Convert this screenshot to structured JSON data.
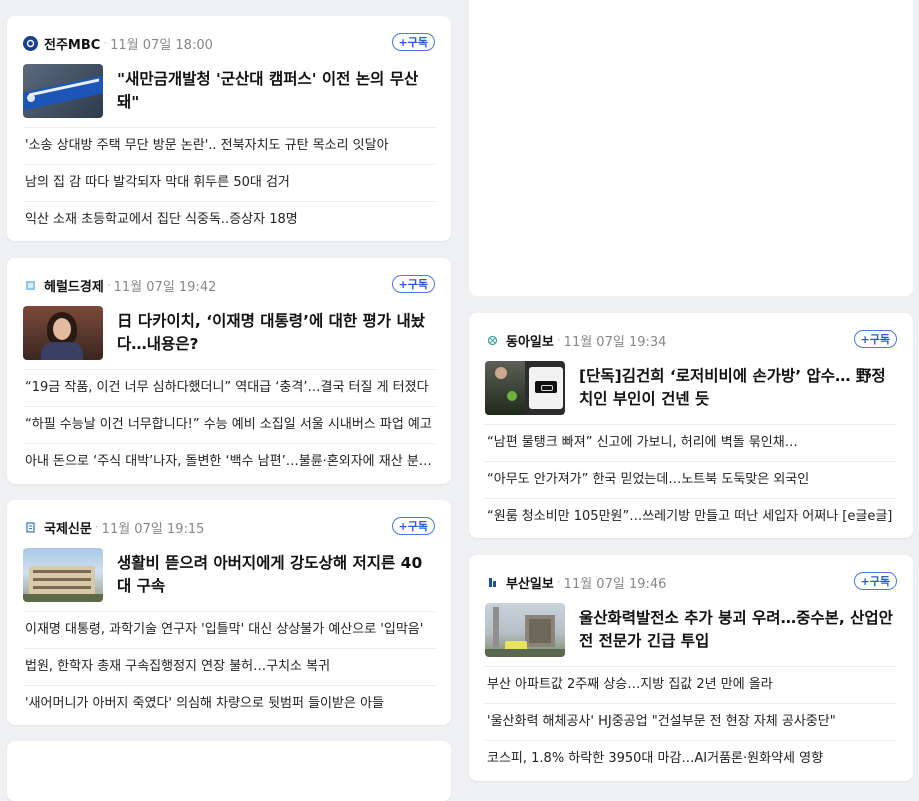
{
  "cards": [
    {
      "press": "전주MBC",
      "time": "11월 07일 18:00",
      "subscribe_label": "+구독",
      "lead_title": "\"새만금개발청 '군산대 캠퍼스' 이전 논의 무산돼\"",
      "items": [
        "'소송 상대방 주택 무단 방문 논란'.. 전북자치도 규탄 목소리 잇달아",
        "남의 집 감 따다 발각되자 막대 휘두른 50대 검거",
        "익산 소재 초등학교에서 집단 식중독..증상자 18명"
      ]
    },
    {
      "press": "헤럴드경제",
      "time": "11월 07일 19:42",
      "subscribe_label": "+구독",
      "lead_title": "日 다카이치, ‘이재명 대통령’에 대한 평가 내놨다…내용은?",
      "items": [
        "“19금 작품, 이건 너무 심하다했더니” 역대급 ‘충격’…결국 터질 게 터졌다",
        "“하필 수능날 이건 너무합니다!” 수능 예비 소집일 서울 시내버스 파업 예고",
        "아내 돈으로 ‘주식 대박’나자, 돌변한 ‘백수 남편’…불륜·혼외자에 재산 분할까지"
      ]
    },
    {
      "press": "국제신문",
      "time": "11월 07일 19:15",
      "subscribe_label": "+구독",
      "lead_title": "생활비 뜯으려 아버지에게 강도상해 저지른 40대 구속",
      "items": [
        "이재명 대통령, 과학기술 연구자 '입틀막' 대신 상상불가 예산으로 '입막음'",
        "법원, 한학자 총재 구속집행정지 연장 불허…구치소 복귀",
        "'새어머니가 아버지 죽였다' 의심해 차량으로 뒷범퍼 들이받은 아들"
      ]
    },
    {
      "press": "동아일보",
      "time": "11월 07일 19:34",
      "subscribe_label": "+구독",
      "lead_title": "[단독]김건희 ‘로저비비에 손가방’ 압수… 野정치인 부인이 건넨 듯",
      "items": [
        "“남편 물탱크 빠져” 신고에 가보니, 허리에 벽돌 묶인채…",
        "“아무도 안가져가” 한국 믿었는데…노트북 도둑맞은 외국인",
        "“원룸 청소비만 105만원”…쓰레기방 만들고 떠난 세입자 어쩌나 [e글e글]"
      ]
    },
    {
      "press": "부산일보",
      "time": "11월 07일 19:46",
      "subscribe_label": "+구독",
      "lead_title": "울산화력발전소 추가 붕괴 우려…중수본, 산업안전 전문가 긴급 투입",
      "items": [
        "부산 아파트값 2주째 상승…지방 집값 2년 만에 올라",
        "'울산화력 해체공사' HJ중공업 \"건설부문 전 현장 자체 공사중단\"",
        "코스피, 1.8% 하락한 3950대 마감…AI거품론·원화약세 영향"
      ]
    }
  ],
  "colors": {
    "subscribe": "#2a5bd7",
    "background": "#eef0f3"
  }
}
